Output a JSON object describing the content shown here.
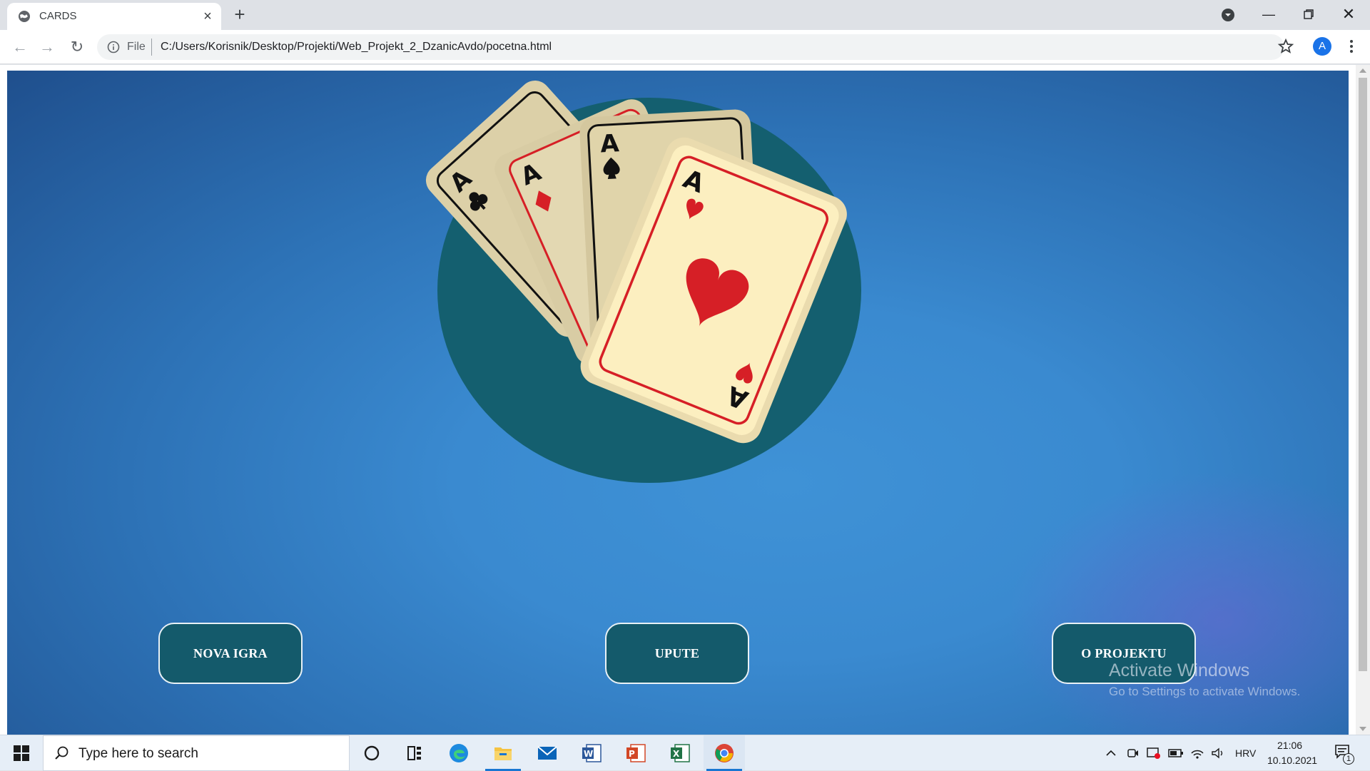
{
  "browser": {
    "tab_title": "CARDS",
    "omnibox_scheme": "File",
    "url": "C:/Users/Korisnik/Desktop/Projekti/Web_Projekt_2_DzanicAvdo/pocetna.html",
    "profile_initial": "A"
  },
  "page": {
    "buttons": [
      {
        "label": "NOVA IGRA"
      },
      {
        "label": "UPUTE"
      },
      {
        "label": "O PROJEKTU"
      }
    ],
    "hero_image": "ace-cards-illustration",
    "colors": {
      "button_bg": "#145a6b",
      "backdrop_circle": "#145f6f",
      "background": "#3a8ad0"
    }
  },
  "watermark": {
    "title": "Activate Windows",
    "subtitle": "Go to Settings to activate Windows."
  },
  "taskbar": {
    "search_placeholder": "Type here to search",
    "language": "HRV",
    "time": "21:06",
    "date": "10.10.2021",
    "notification_count": "1",
    "apps": [
      "cortana-icon",
      "task-view-icon",
      "edge-icon",
      "file-explorer-icon",
      "mail-icon",
      "word-icon",
      "powerpoint-icon",
      "excel-icon",
      "chrome-icon"
    ]
  }
}
